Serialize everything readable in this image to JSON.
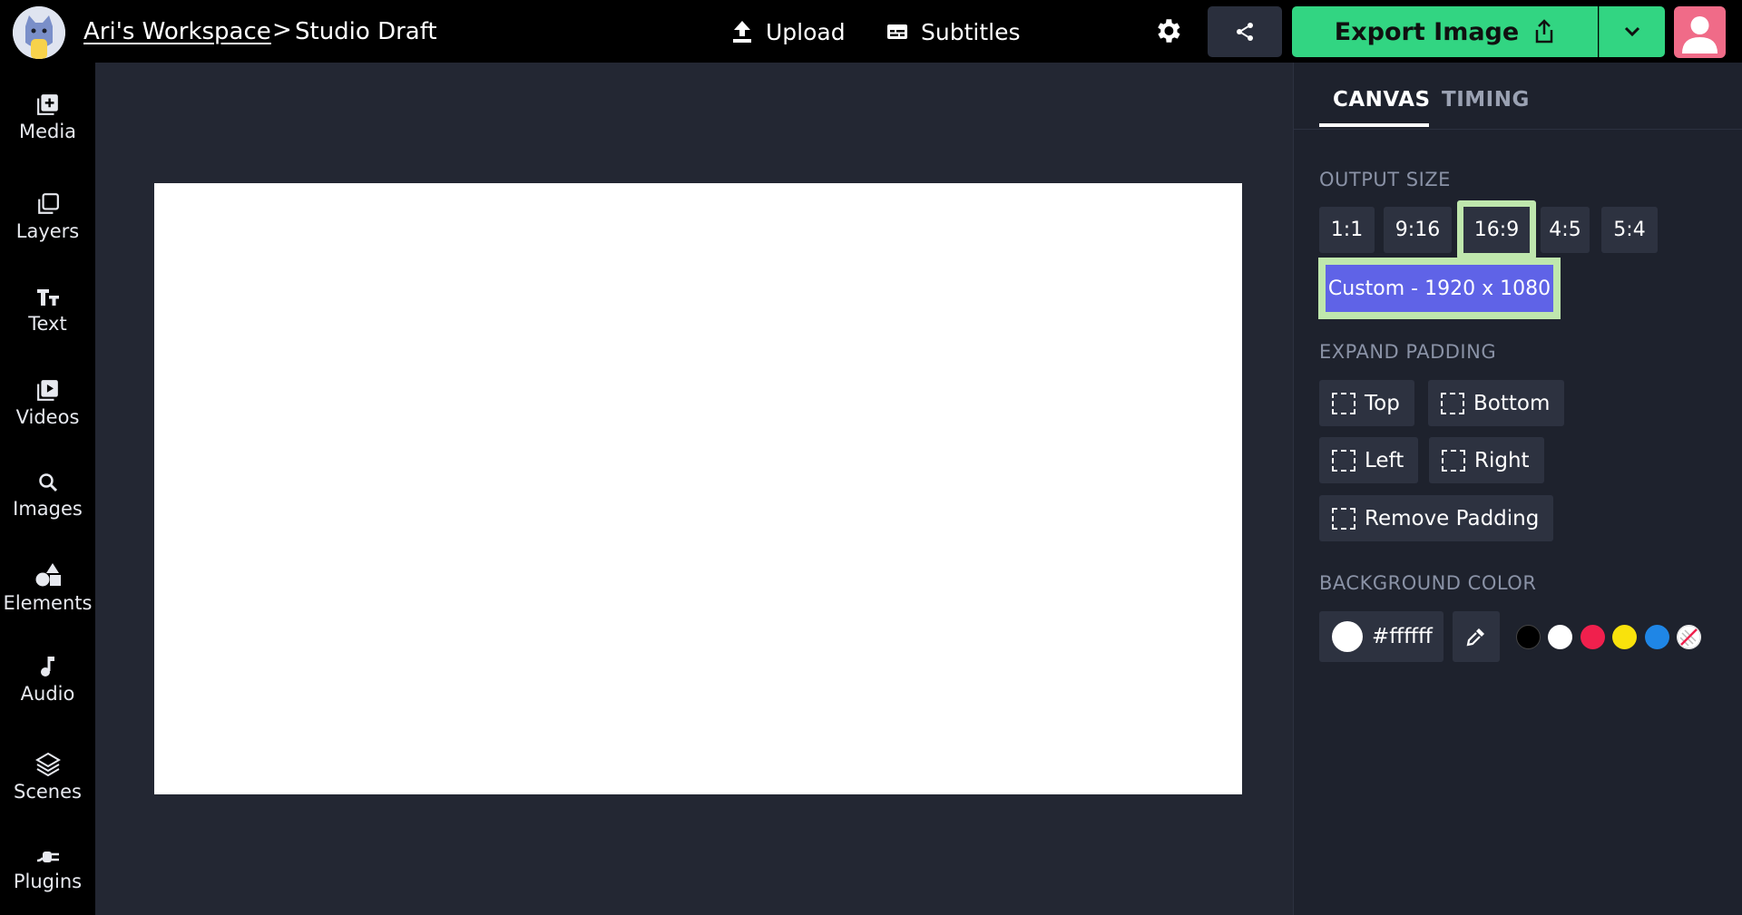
{
  "header": {
    "workspace": "Ari's Workspace",
    "separator": ">",
    "title": "Studio Draft",
    "upload_label": "Upload",
    "subtitles_label": "Subtitles",
    "export_label": "Export Image"
  },
  "sidebar": {
    "items": [
      {
        "label": "Media",
        "icon": "media-add-icon"
      },
      {
        "label": "Layers",
        "icon": "layers-icon"
      },
      {
        "label": "Text",
        "icon": "text-icon"
      },
      {
        "label": "Videos",
        "icon": "video-icon"
      },
      {
        "label": "Images",
        "icon": "search-icon"
      },
      {
        "label": "Elements",
        "icon": "shapes-icon"
      },
      {
        "label": "Audio",
        "icon": "music-note-icon"
      },
      {
        "label": "Scenes",
        "icon": "stack-icon"
      },
      {
        "label": "Plugins",
        "icon": "plug-icon"
      }
    ]
  },
  "panel": {
    "tabs": [
      {
        "label": "CANVAS",
        "active": true
      },
      {
        "label": "TIMING",
        "active": false
      }
    ],
    "output_size": {
      "title": "OUTPUT SIZE",
      "ratios": [
        "1:1",
        "9:16",
        "16:9",
        "4:5",
        "5:4"
      ],
      "selected": "16:9",
      "custom_label": "Custom - 1920 x 1080"
    },
    "padding": {
      "title": "EXPAND PADDING",
      "buttons": [
        "Top",
        "Bottom",
        "Left",
        "Right",
        "Remove Padding"
      ]
    },
    "background": {
      "title": "BACKGROUND COLOR",
      "value": "#ffffff",
      "swatches": [
        "#000000",
        "#ffffff",
        "#f0204d",
        "#f9e20c",
        "#1f86e6",
        "transparent"
      ]
    }
  },
  "colors": {
    "accent_green": "#32d582",
    "highlight": "#bfe7ad",
    "custom_button": "#5f63e7",
    "workspace_bg": "#232733",
    "panel_bg": "#1e222d"
  }
}
